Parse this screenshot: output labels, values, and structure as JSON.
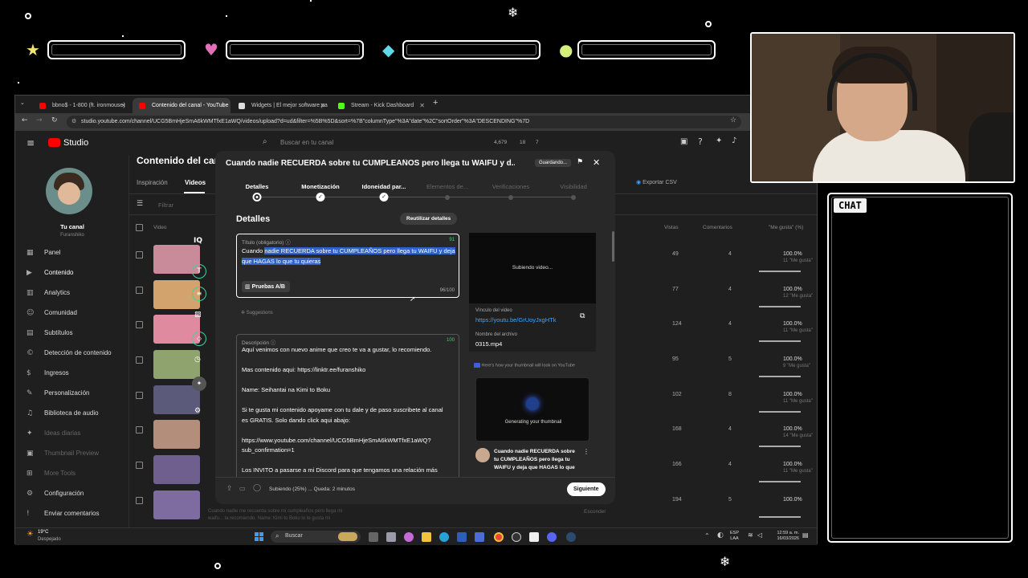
{
  "overlay": {
    "chat_label": "CHAT",
    "icons": [
      "star-icon",
      "heart-icon",
      "diamond-icon",
      "coin-icon"
    ]
  },
  "browser": {
    "tabs": [
      {
        "label": "bbno$ - 1-800 (ft. ironmouse)",
        "active": false,
        "favicon_color": "#ff0000"
      },
      {
        "label": "Contenido del canal - YouTube",
        "active": true,
        "favicon_color": "#ff0000"
      },
      {
        "label": "Widgets | El mejor software pa",
        "active": false,
        "favicon_color": "#dddddd"
      },
      {
        "label": "Stream - Kick Dashboard",
        "active": false,
        "favicon_color": "#53fc18"
      }
    ],
    "url": "studio.youtube.com/channel/UCG5BmHjeSmA6kWMTfxE1aWQ/videos/upload?d=ud&filter=%5B%5D&sort=%7B\"columnType\"%3A\"date\"%2C\"sortOrder\"%3A\"DESCENDING\"%7D"
  },
  "studio": {
    "logo": "Studio",
    "search_placeholder": "Buscar en tu canal",
    "stats": "4,679",
    "stats2": "18",
    "stats3": "7",
    "channel_label": "Tu canal",
    "channel_name": "Furanshiko",
    "page_title": "Contenido del canal",
    "tabs": [
      "Inspiración",
      "Videos"
    ],
    "filter_placeholder": "Filtrar",
    "col_video": "Video",
    "col_views": "Vistas",
    "col_comments": "Comentarios",
    "col_likes": "\"Me gusta\" (%)",
    "export": "Exportar CSV",
    "sidebar": [
      {
        "icon": "dashboard-icon",
        "glyph": "▦",
        "label": "Panel"
      },
      {
        "icon": "content-icon",
        "glyph": "▶",
        "label": "Contenido"
      },
      {
        "icon": "analytics-icon",
        "glyph": "▥",
        "label": "Analytics"
      },
      {
        "icon": "community-icon",
        "glyph": "☺",
        "label": "Comunidad"
      },
      {
        "icon": "subtitles-icon",
        "glyph": "▤",
        "label": "Subtítulos"
      },
      {
        "icon": "copyright-icon",
        "glyph": "©",
        "label": "Detección de contenido"
      },
      {
        "icon": "earn-icon",
        "glyph": "$",
        "label": "Ingresos"
      },
      {
        "icon": "customize-icon",
        "glyph": "✎",
        "label": "Personalización"
      },
      {
        "icon": "audio-library-icon",
        "glyph": "♫",
        "label": "Biblioteca de audio"
      },
      {
        "icon": "ideas-icon",
        "glyph": "✦",
        "label": "Ideas diarias"
      },
      {
        "icon": "thumbnail-preview-icon",
        "glyph": "▣",
        "label": "Thumbnail Preview"
      },
      {
        "icon": "more-tools-icon",
        "glyph": "⊞",
        "label": "More Tools"
      },
      {
        "icon": "settings-icon",
        "glyph": "⚙",
        "label": "Configuración"
      },
      {
        "icon": "feedback-icon",
        "glyph": "!",
        "label": "Enviar comentarios"
      }
    ],
    "rows": [
      {
        "views": "49",
        "comments": "4",
        "likes": "100.0%",
        "likes_sub": "11 \"Me gusta\"",
        "thumb": "#c98a9a"
      },
      {
        "views": "77",
        "comments": "4",
        "likes": "100.0%",
        "likes_sub": "12 \"Me gusta\"",
        "thumb": "#d2a36c"
      },
      {
        "views": "124",
        "comments": "4",
        "likes": "100.0%",
        "likes_sub": "11 \"Me gusta\"",
        "thumb": "#e08aa0"
      },
      {
        "views": "95",
        "comments": "5",
        "likes": "100.0%",
        "likes_sub": "9 \"Me gusta\"",
        "thumb": "#8fa36e"
      },
      {
        "views": "102",
        "comments": "8",
        "likes": "100.0%",
        "likes_sub": "11 \"Me gusta\"",
        "thumb": "#5c5a7a"
      },
      {
        "views": "168",
        "comments": "4",
        "likes": "100.0%",
        "likes_sub": "14 \"Me gusta\"",
        "thumb": "#b38e7a"
      },
      {
        "views": "166",
        "comments": "4",
        "likes": "100.0%",
        "likes_sub": "11 \"Me gusta\"",
        "thumb": "#6f5f8e"
      },
      {
        "views": "194",
        "comments": "5",
        "likes": "100.0%",
        "likes_sub": "",
        "thumb": "#7e6ca0"
      }
    ],
    "last_row_desc": "Cuando nadie me recuerda sobre mi cumpleaños pero llega mi waifu... la recomiendo. Name: Kimi to Boku lo te gusta mi",
    "last_row_status": "Esconder"
  },
  "modal": {
    "title": "Cuando nadie RECUERDA sobre tu CUMPLEAÑOS pero llega tu WAIFU y d...",
    "saving_badge": "Guardando...",
    "steps": [
      {
        "label": "Detalles",
        "state": "current"
      },
      {
        "label": "Monetización",
        "state": "done"
      },
      {
        "label": "Idoneidad par...",
        "state": "done"
      },
      {
        "label": "Elementos de...",
        "state": "todo"
      },
      {
        "label": "Verificaciones",
        "state": "todo"
      },
      {
        "label": "Visibilidad",
        "state": "todo"
      }
    ],
    "section_title": "Detalles",
    "reuse_button": "Reutilizar detalles",
    "title_field": {
      "label": "Título (obligatorio)",
      "value_plain": "Cuando ",
      "value_selected": "nadie RECUERDA sobre tu CUMPLEAÑOS pero llega tu WAIFU y deja que HAGAS lo que tu quieras",
      "remaining": "91",
      "counter": "96/100"
    },
    "ab_button": "Pruebas A/B",
    "suggestions": "Suggestions",
    "description_field": {
      "label": "Descripción",
      "remaining": "100",
      "lines": [
        "Aquí venimos con nuevo anime que creo te va a gustar, lo recomiendo.",
        "",
        "Mas contenido aqui: https://linktr.ee/furanshiko",
        "",
        "Name: Seihantai na Kimi to Boku",
        "",
        "Si te gusta mi contenido apoyame con tu dale y de paso suscribete al canal",
        "es GRATIS. Solo dando click aqui abajo:",
        "",
        "https://www.youtube.com/channel/UCG5BmHjeSmA6kWMTfxE1aWQ?",
        "sub_confirmation=1",
        "",
        "Los INVITO a pasarse a mi Discord para que tengamos una relación más"
      ]
    },
    "video_card": {
      "uploading": "Subiendo video...",
      "link_label": "Vínculo del video",
      "link": "https://youtu.be/GrUoyJxgHTk",
      "filename_label": "Nombre del archivo",
      "filename": "0315.mp4"
    },
    "thumb_notice": "Here's how your thumbnail will look on YouTube",
    "thumb_generating": "Generating your thumbnail",
    "thumb_title": "Cuando nadie RECUERDA sobre tu CUMPLEAÑOS pero llega tu WAIFU y deja que HAGAS lo que",
    "footer_status": "Subiendo (25%) ... Queda: 2 minutos",
    "upload_progress": 0.25,
    "next_button": "Siguiente"
  },
  "taskbar": {
    "temp": "19°C",
    "weather": "Despejado",
    "search": "Buscar",
    "lang": "ESP",
    "lang2": "LAA",
    "time": "12:59 a. m.",
    "date": "16/03/2026"
  }
}
